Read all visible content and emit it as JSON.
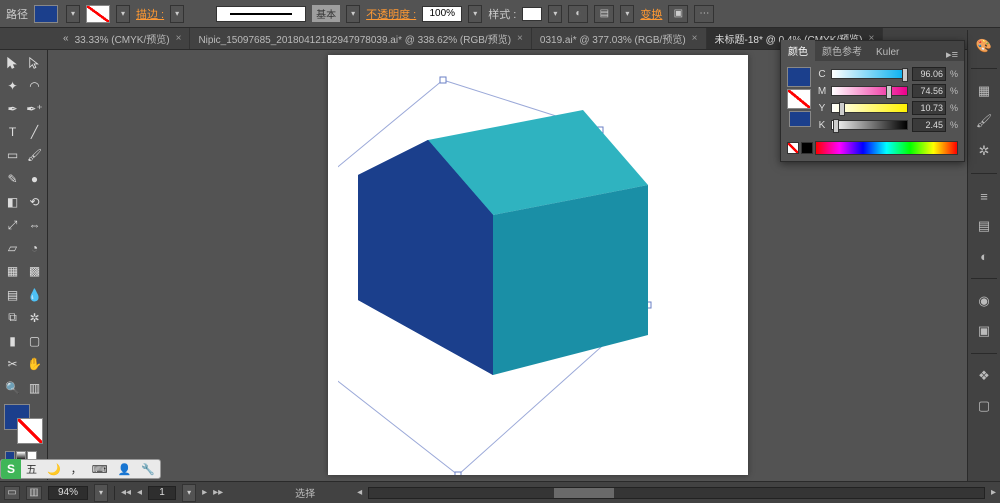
{
  "control_bar": {
    "path_label": "路径",
    "stroke_link": "描边 :",
    "brush_label": "基本",
    "opacity_label": "不透明度 :",
    "opacity_val": "100%",
    "style_label": "样式 :",
    "transform_link": "变换"
  },
  "tabs": [
    {
      "label": "33.33% (CMYK/预览)"
    },
    {
      "label": "Nipic_15097685_20180412182947978039.ai* @ 338.62% (RGB/预览)"
    },
    {
      "label": "0319.ai* @ 377.03% (RGB/预览)"
    },
    {
      "label": "未标题-18* @ 0.4% (CMYK/预览)"
    }
  ],
  "color_panel": {
    "tab1": "颜色",
    "tab2": "颜色参考",
    "tab3": "Kuler",
    "c_label": "C",
    "c_val": "96.06",
    "m_label": "M",
    "m_val": "74.56",
    "y_label": "Y",
    "y_val": "10.73",
    "k_label": "K",
    "k_val": "2.45",
    "pct": "%"
  },
  "status": {
    "zoom": "94%",
    "artboard_nav": "1",
    "select_label": "选择"
  },
  "ime": {
    "brand": "S",
    "mode": "五"
  }
}
